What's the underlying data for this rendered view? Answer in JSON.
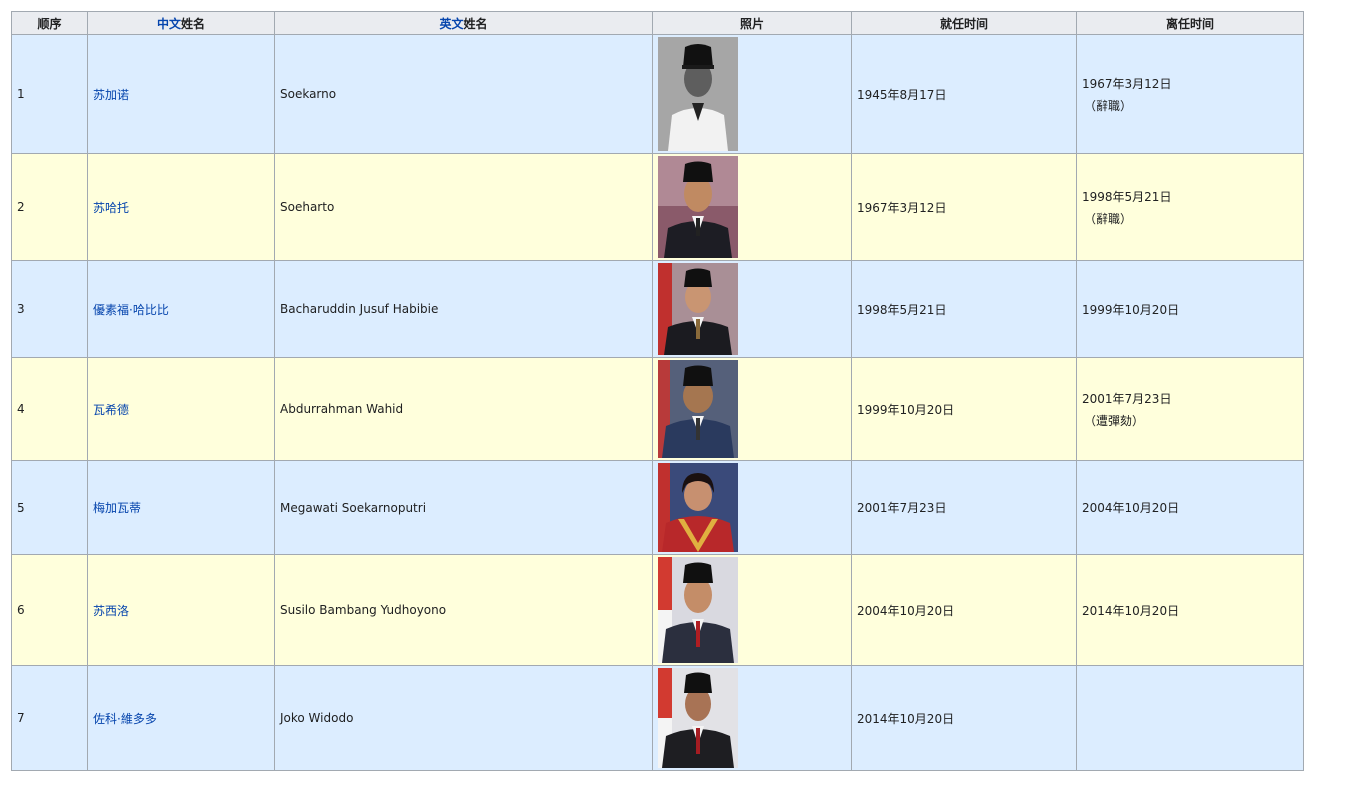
{
  "header": {
    "col_index": "顺序",
    "col_cn_name_link": "中文",
    "col_cn_name_rest": "姓名",
    "col_en_name_link": "英文",
    "col_en_name_rest": "姓名",
    "col_photo": "照片",
    "col_start": "就任时间",
    "col_end": "离任时间"
  },
  "rows": [
    {
      "index": "1",
      "cn_name": "苏加诺",
      "en_name": "Soekarno",
      "start": "1945年8月17日",
      "end": "1967年3月12日",
      "end_note": "（辭職）",
      "photo": "soekarno-portrait",
      "bg": "blue"
    },
    {
      "index": "2",
      "cn_name": "苏哈托",
      "en_name": "Soeharto",
      "start": "1967年3月12日",
      "end": "1998年5月21日",
      "end_note": "（辭職）",
      "photo": "soeharto-portrait",
      "bg": "yellow"
    },
    {
      "index": "3",
      "cn_name": "優素福·哈比比",
      "en_name": "Bacharuddin Jusuf Habibie",
      "start": "1998年5月21日",
      "end": "1999年10月20日",
      "end_note": "",
      "photo": "habibie-portrait",
      "bg": "blue"
    },
    {
      "index": "4",
      "cn_name": "瓦希德",
      "en_name": "Abdurrahman Wahid",
      "start": "1999年10月20日",
      "end": "2001年7月23日",
      "end_note": "（遭彈劾）",
      "photo": "wahid-portrait",
      "bg": "yellow"
    },
    {
      "index": "5",
      "cn_name": "梅加瓦蒂",
      "en_name": "Megawati Soekarnoputri",
      "start": "2001年7月23日",
      "end": "2004年10月20日",
      "end_note": "",
      "photo": "megawati-portrait",
      "bg": "blue"
    },
    {
      "index": "6",
      "cn_name": "苏西洛",
      "en_name": "Susilo Bambang Yudhoyono",
      "start": "2004年10月20日",
      "end": "2014年10月20日",
      "end_note": "",
      "photo": "yudhoyono-portrait",
      "bg": "yellow"
    },
    {
      "index": "7",
      "cn_name": "佐科·維多多",
      "en_name": "Joko Widodo",
      "start": "2014年10月20日",
      "end": "",
      "end_note": "",
      "photo": "widodo-portrait",
      "bg": "blue"
    }
  ]
}
